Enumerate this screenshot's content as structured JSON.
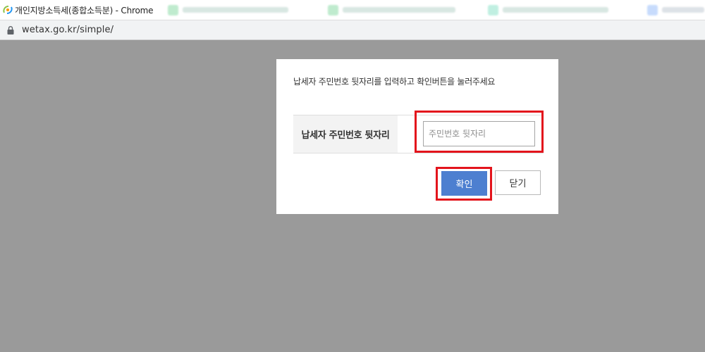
{
  "window": {
    "title": "개인지방소득세(종합소득분) - Chrome",
    "icon": "wetax-logo-icon"
  },
  "background_tabs": [
    {
      "favicon_color": "#1db954"
    },
    {
      "favicon_color": "#1db954"
    },
    {
      "favicon_color": "#20c997"
    },
    {
      "favicon_color": "#3b82f6"
    }
  ],
  "address_bar": {
    "url": "wetax.go.kr/simple/",
    "icon": "lock-icon"
  },
  "dialog": {
    "instruction": "납세자 주민번호 뒷자리를 입력하고 확인버튼을 눌러주세요",
    "field_label": "납세자 주민번호 뒷자리",
    "input": {
      "value": "",
      "placeholder": "주민번호 뒷자리"
    },
    "buttons": {
      "confirm": "확인",
      "close": "닫기"
    }
  },
  "colors": {
    "overlay": "#9a9a9a",
    "confirm_button": "#4d7fd0",
    "highlight_box": "#e3141c"
  }
}
